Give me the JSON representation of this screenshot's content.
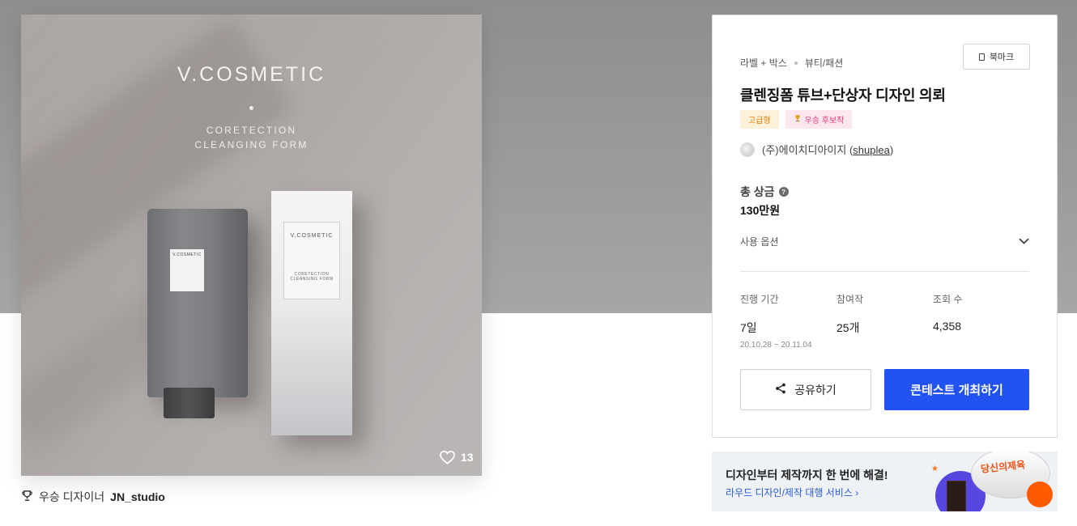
{
  "product_image": {
    "brand": "V.COSMETIC",
    "subtitle_line1": "CORETECTION",
    "subtitle_line2": "CLEANGING FORM",
    "tube_label": "V.COSMETIC",
    "box_brand": "V.COSMETIC",
    "box_subtitle_line1": "CORETECTION",
    "box_subtitle_line2": "CLEANSING FORM",
    "like_count": "13",
    "like_icon": "heart-icon"
  },
  "winner": {
    "icon": "trophy-icon",
    "label": "우승 디자이너",
    "name": "JN_studio"
  },
  "contest": {
    "category_primary": "라벨 + 박스",
    "category_secondary": "뷰티/패션",
    "bookmark_label": "북마크",
    "title": "클렌징폼 튜브+단상자 디자인 의뢰",
    "badges": {
      "premium": "고급형",
      "candidate": "우승 후보작"
    },
    "owner": {
      "name": "(주)에이치디아이지",
      "handle_open": " (",
      "handle": "shuplea",
      "handle_close": ")"
    },
    "prize_label": "총 상금",
    "prize_value": "130만원",
    "options_label": "사용 옵션",
    "stats": {
      "period_label": "진행 기간",
      "period_value": "7일",
      "period_start": "20.10.28",
      "period_sep": "~",
      "period_end": "20.11.04",
      "entries_label": "참여작",
      "entries_value": "25개",
      "views_label": "조회 수",
      "views_value": "4,358"
    },
    "share_label": "공유하기",
    "host_label": "콘테스트 개최하기"
  },
  "promo": {
    "title": "디자인부터 제작까지 한 번에 해결!",
    "link": "라우드 디자인/제작 대행 서비스",
    "art_text": "당신의제육"
  },
  "colors": {
    "primary_button": "#2253f2",
    "premium_badge_text": "#d87b00",
    "candidate_badge_text": "#e83a6e",
    "promo_link": "#2a5ad8"
  }
}
